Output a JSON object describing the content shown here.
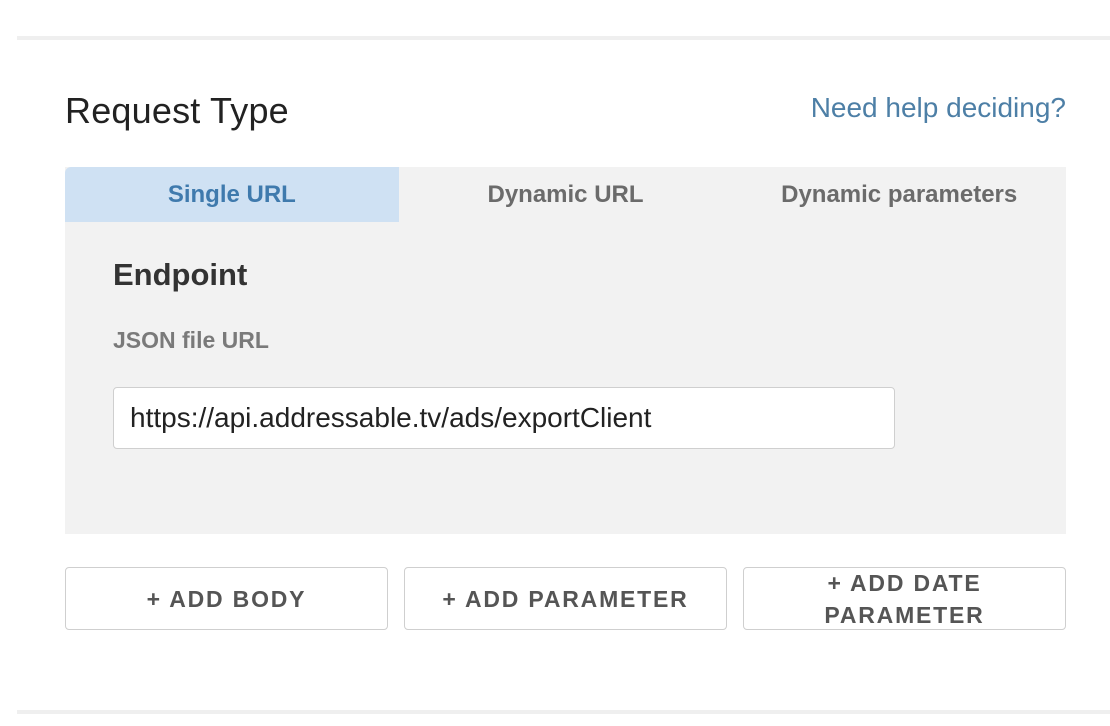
{
  "section": {
    "title": "Request Type",
    "help_link": "Need help deciding?"
  },
  "tabs": [
    {
      "label": "Single URL",
      "active": true
    },
    {
      "label": "Dynamic URL",
      "active": false
    },
    {
      "label": "Dynamic parameters",
      "active": false
    }
  ],
  "endpoint": {
    "title": "Endpoint",
    "field_label": "JSON file URL",
    "url_value": "https://api.addressable.tv/ads/exportClient"
  },
  "buttons": {
    "add_body": "+ ADD BODY",
    "add_parameter": "+ ADD PARAMETER",
    "add_date_parameter": "+ ADD DATE PARAMETER"
  },
  "colors": {
    "accent": "#4d7fa6",
    "active_tab_bg": "#cfe1f3",
    "panel_bg": "#f2f2f2"
  }
}
